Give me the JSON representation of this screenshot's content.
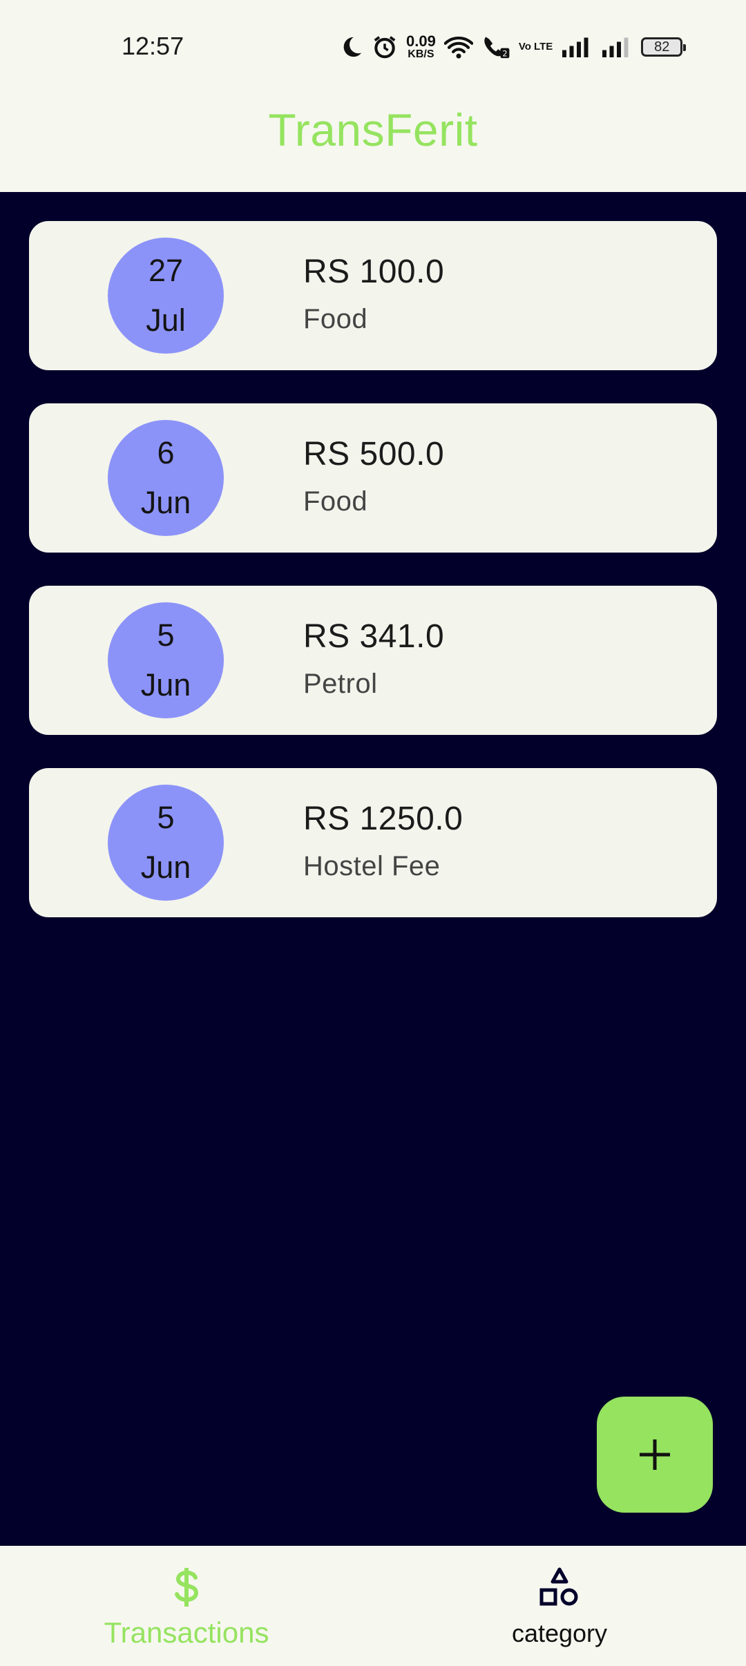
{
  "status_bar": {
    "time": "12:57",
    "speed_value": "0.09",
    "speed_unit": "KB/S",
    "volte": "Vo LTE",
    "battery": "82",
    "icons": [
      "moon-icon",
      "alarm-icon",
      "wifi-icon",
      "wifi-calling-icon",
      "volte-icon",
      "signal-icon",
      "signal-icon",
      "battery-icon"
    ]
  },
  "app_bar": {
    "title": "TransFerit",
    "title_color": "#95e35f"
  },
  "transactions": [
    {
      "day": "27",
      "month": "Jul",
      "amount": "RS 100.0",
      "category": "Food"
    },
    {
      "day": "6",
      "month": "Jun",
      "amount": "RS 500.0",
      "category": "Food"
    },
    {
      "day": "5",
      "month": "Jun",
      "amount": "RS 341.0",
      "category": "Petrol"
    },
    {
      "day": "5",
      "month": "Jun",
      "amount": "RS 1250.0",
      "category": "Hostel Fee"
    }
  ],
  "fab": {
    "icon": "plus-icon",
    "color": "#95e35f"
  },
  "bottom_nav": {
    "items": [
      {
        "label": "Transactions",
        "icon": "dollar-icon",
        "active": true
      },
      {
        "label": "category",
        "icon": "shapes-icon",
        "active": false
      }
    ]
  },
  "colors": {
    "background": "#02002a",
    "surface": "#f6f7ef",
    "card": "#f3f4ec",
    "date_circle": "#8c93f8",
    "accent": "#95e35f"
  }
}
